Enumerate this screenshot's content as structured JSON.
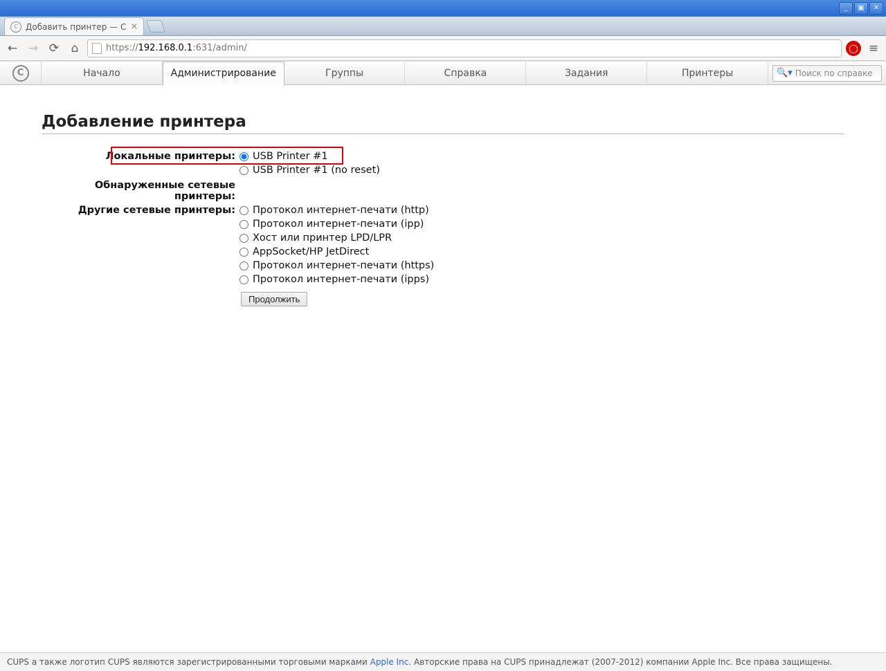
{
  "window": {
    "tab_title": "Добавить принтер — C",
    "url_scheme": "https://",
    "url_host": "192.168.0.1",
    "url_rest": ":631/admin/"
  },
  "nav": {
    "items": [
      "Начало",
      "Администрирование",
      "Группы",
      "Справка",
      "Задания",
      "Принтеры"
    ],
    "active_index": 1,
    "search_placeholder": "Поиск по справке"
  },
  "page": {
    "title": "Добавление принтера",
    "sections": {
      "local": {
        "label": "Локальные принтеры:",
        "options": [
          "USB Printer #1",
          "USB Printer #1 (no reset)"
        ],
        "selected_index": 0
      },
      "discovered": {
        "label": "Обнаруженные сетевые принтеры:"
      },
      "other": {
        "label": "Другие сетевые принтеры:",
        "options": [
          "Протокол интернет-печати (http)",
          "Протокол интернет-печати (ipp)",
          "Хост или принтер LPD/LPR",
          "AppSocket/HP JetDirect",
          "Протокол интернет-печати (https)",
          "Протокол интернет-печати (ipps)"
        ]
      }
    },
    "continue_label": "Продолжить"
  },
  "footer": {
    "pre": "CUPS а также логотип CUPS являются зарегистрированными торговыми марками ",
    "link": "Apple Inc.",
    "post": " Авторские права на CUPS принадлежат (2007-2012) компании Apple Inc. Все права защищены."
  }
}
